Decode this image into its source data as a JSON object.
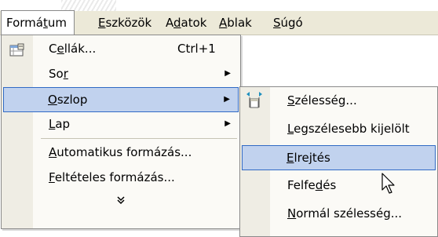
{
  "menubar": {
    "items": [
      {
        "pre": "Formá",
        "u": "t",
        "post": "um"
      },
      {
        "pre": "",
        "u": "E",
        "post": "szközök"
      },
      {
        "pre": "A",
        "u": "d",
        "post": "atok"
      },
      {
        "pre": "",
        "u": "A",
        "post": "blak"
      },
      {
        "pre": "",
        "u": "S",
        "post": "úgó"
      }
    ]
  },
  "format_menu": {
    "items": [
      {
        "pre": "C",
        "u": "e",
        "post": "llák...",
        "shortcut": "Ctrl+1"
      },
      {
        "pre": "So",
        "u": "r",
        "post": ""
      },
      {
        "pre": "",
        "u": "O",
        "post": "szlop"
      },
      {
        "pre": "",
        "u": "L",
        "post": "ap"
      },
      {
        "pre": "",
        "u": "A",
        "post": "utomatikus formázás..."
      },
      {
        "pre": "",
        "u": "F",
        "post": "eltételes formázás..."
      }
    ],
    "expand": "¤"
  },
  "column_submenu": {
    "items": [
      {
        "pre": "",
        "u": "S",
        "post": "zélesség..."
      },
      {
        "pre": "",
        "u": "L",
        "post": "egszélesebb kijelölt"
      },
      {
        "pre": "",
        "u": "E",
        "post": "lrejtés"
      },
      {
        "pre": "Felfe",
        "u": "d",
        "post": "és"
      },
      {
        "pre": "",
        "u": "N",
        "post": "ormál szélesség..."
      }
    ]
  },
  "icons": {
    "cells": "format-cells-icon",
    "column_width": "column-width-icon",
    "cursor": "mouse-pointer-icon"
  },
  "colors": {
    "highlight": "#c1d2ee",
    "highlight_border": "#316ac5",
    "menubar": "#ece9d8"
  }
}
